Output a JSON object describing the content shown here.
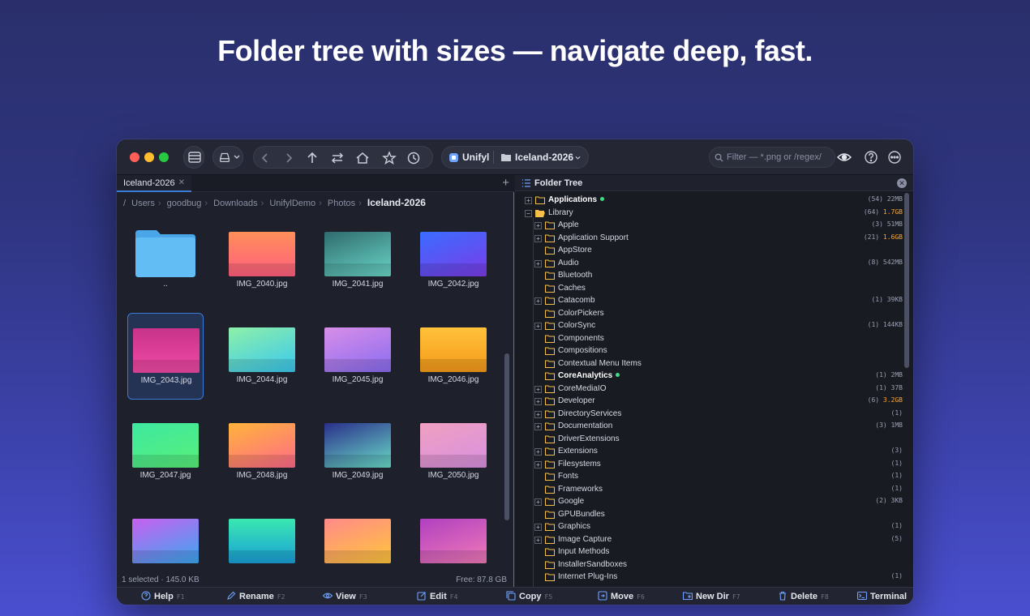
{
  "headline": "Folder tree with sizes — navigate deep, fast.",
  "colors": {
    "accent": "#3a7bd5",
    "folder": "#f5c04a",
    "online_dot": "#3ddc84",
    "size_highlight": "#ffa726"
  },
  "toolbar": {
    "workspace": "Unifyl",
    "folder": "Iceland-2026",
    "search_placeholder": "Filter — *.png or /regex/"
  },
  "left_pane": {
    "tab_label": "Iceland-2026",
    "breadcrumb": [
      "/",
      "Users",
      "goodbug",
      "Downloads",
      "UnifylDemo",
      "Photos",
      "Iceland-2026"
    ],
    "tiles": [
      {
        "label": "..",
        "kind": "folder"
      },
      {
        "label": "IMG_2040.jpg",
        "gradient": "linear-gradient(180deg,#ff8f5a,#ff5f7e)"
      },
      {
        "label": "IMG_2041.jpg",
        "gradient": "linear-gradient(160deg,#2f6b6e,#6ad6c8)"
      },
      {
        "label": "IMG_2042.jpg",
        "gradient": "linear-gradient(160deg,#3a6dff,#7b3ce8)"
      },
      {
        "label": "IMG_2043.jpg",
        "gradient": "linear-gradient(180deg,#c8338a,#f04aa5)",
        "selected": true
      },
      {
        "label": "IMG_2044.jpg",
        "gradient": "linear-gradient(160deg,#8ef0a8,#3ac8f0)"
      },
      {
        "label": "IMG_2045.jpg",
        "gradient": "linear-gradient(160deg,#d88ee8,#8a6cf0)"
      },
      {
        "label": "IMG_2046.jpg",
        "gradient": "linear-gradient(180deg,#ffc23a,#f59a1a)"
      },
      {
        "label": "IMG_2047.jpg",
        "gradient": "linear-gradient(160deg,#3de8a0,#5af07a)"
      },
      {
        "label": "IMG_2048.jpg",
        "gradient": "linear-gradient(160deg,#ffb43a,#ff6a8a)"
      },
      {
        "label": "IMG_2049.jpg",
        "gradient": "linear-gradient(160deg,#2a2f8a,#6adcc8)"
      },
      {
        "label": "IMG_2050.jpg",
        "gradient": "linear-gradient(160deg,#f0a0c0,#d890e0)"
      },
      {
        "label": "",
        "gradient": "linear-gradient(160deg,#c860f0,#3aa8f0)"
      },
      {
        "label": "",
        "gradient": "linear-gradient(180deg,#3ae8b0,#1a9fd8)"
      },
      {
        "label": "",
        "gradient": "linear-gradient(160deg,#ff8a8a,#ffc63a)"
      },
      {
        "label": "",
        "gradient": "linear-gradient(160deg,#b040c0,#f07ab8)"
      }
    ],
    "status_selected": "1 selected · 145.0 KB",
    "status_free": "Free: 87.8 GB"
  },
  "tree": {
    "title": "Folder Tree",
    "rows": [
      {
        "name": "Applications",
        "level": 0,
        "exp": "+",
        "bold": true,
        "dot": true,
        "count": "(54)",
        "size": "22MB"
      },
      {
        "name": "Library",
        "level": 0,
        "exp": "−",
        "open": true,
        "count": "(64)",
        "size": "1.7GB",
        "hl": true
      },
      {
        "name": "Apple",
        "level": 1,
        "exp": "+",
        "count": "(3)",
        "size": "51MB"
      },
      {
        "name": "Application Support",
        "level": 1,
        "exp": "+",
        "count": "(21)",
        "size": "1.6GB",
        "hl": true
      },
      {
        "name": "AppStore",
        "level": 1
      },
      {
        "name": "Audio",
        "level": 1,
        "exp": "+",
        "count": "(8)",
        "size": "542MB"
      },
      {
        "name": "Bluetooth",
        "level": 1
      },
      {
        "name": "Caches",
        "level": 1
      },
      {
        "name": "Catacomb",
        "level": 1,
        "exp": "+",
        "count": "(1)",
        "size": "39KB"
      },
      {
        "name": "ColorPickers",
        "level": 1
      },
      {
        "name": "ColorSync",
        "level": 1,
        "exp": "+",
        "count": "(1)",
        "size": "144KB"
      },
      {
        "name": "Components",
        "level": 1
      },
      {
        "name": "Compositions",
        "level": 1
      },
      {
        "name": "Contextual Menu Items",
        "level": 1
      },
      {
        "name": "CoreAnalytics",
        "level": 1,
        "bold": true,
        "dot": true,
        "count": "(1)",
        "size": "2MB"
      },
      {
        "name": "CoreMediaIO",
        "level": 1,
        "exp": "+",
        "count": "(1)",
        "size": "37B"
      },
      {
        "name": "Developer",
        "level": 1,
        "exp": "+",
        "count": "(6)",
        "size": "3.2GB",
        "hl": true
      },
      {
        "name": "DirectoryServices",
        "level": 1,
        "exp": "+",
        "count": "(1)",
        "size": ""
      },
      {
        "name": "Documentation",
        "level": 1,
        "exp": "+",
        "count": "(3)",
        "size": "1MB"
      },
      {
        "name": "DriverExtensions",
        "level": 1
      },
      {
        "name": "Extensions",
        "level": 1,
        "exp": "+",
        "count": "(3)",
        "size": ""
      },
      {
        "name": "Filesystems",
        "level": 1,
        "exp": "+",
        "count": "(1)",
        "size": ""
      },
      {
        "name": "Fonts",
        "level": 1,
        "count": "(1)",
        "size": ""
      },
      {
        "name": "Frameworks",
        "level": 1,
        "count": "(1)",
        "size": ""
      },
      {
        "name": "Google",
        "level": 1,
        "exp": "+",
        "count": "(2)",
        "size": "3KB"
      },
      {
        "name": "GPUBundles",
        "level": 1
      },
      {
        "name": "Graphics",
        "level": 1,
        "exp": "+",
        "count": "(1)",
        "size": ""
      },
      {
        "name": "Image Capture",
        "level": 1,
        "exp": "+",
        "count": "(5)",
        "size": ""
      },
      {
        "name": "Input Methods",
        "level": 1
      },
      {
        "name": "InstallerSandboxes",
        "level": 1
      },
      {
        "name": "Internet Plug-Ins",
        "level": 1,
        "count": "(1)",
        "size": ""
      }
    ]
  },
  "fnbar": [
    {
      "label": "Help",
      "key": "F1",
      "icon": "help-icon"
    },
    {
      "label": "Rename",
      "key": "F2",
      "icon": "pencil-icon"
    },
    {
      "label": "View",
      "key": "F3",
      "icon": "eye-icon"
    },
    {
      "label": "Edit",
      "key": "F4",
      "icon": "edit-icon"
    },
    {
      "label": "Copy",
      "key": "F5",
      "icon": "copy-icon"
    },
    {
      "label": "Move",
      "key": "F6",
      "icon": "move-icon"
    },
    {
      "label": "New Dir",
      "key": "F7",
      "icon": "new-folder-icon"
    },
    {
      "label": "Delete",
      "key": "F8",
      "icon": "trash-icon"
    },
    {
      "label": "Terminal",
      "key": "",
      "icon": "terminal-icon"
    }
  ]
}
